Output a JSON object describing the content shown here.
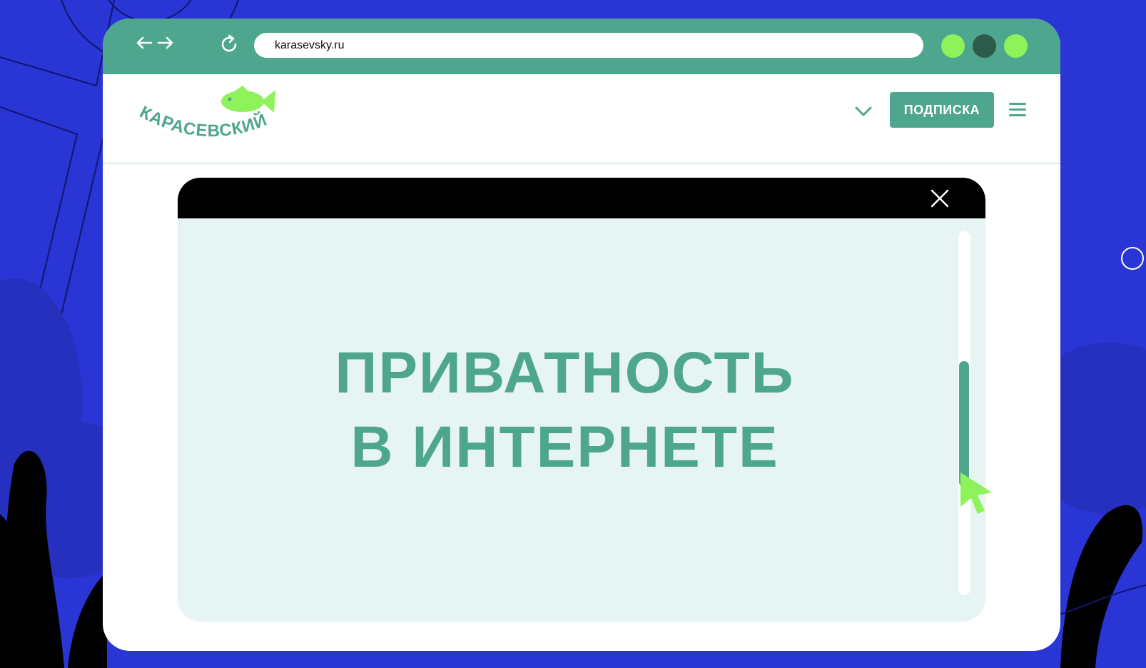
{
  "browser": {
    "url": "karasevsky.ru",
    "traffic_dots": [
      "#8ef25a",
      "#2e5a4c",
      "#8ef25a"
    ]
  },
  "site": {
    "logo_text": "КАРАСЕВСКИЙ",
    "subscribe_label": "ПОДПИСКА"
  },
  "modal": {
    "headline_line1": "ПРИВАТНОСТЬ",
    "headline_line2": "В ИНТЕРНЕТЕ",
    "scroll_position": 0.37
  },
  "colors": {
    "background": "#2a35d6",
    "accent": "#4fa68e",
    "fish": "#8ef25a",
    "modal_bg": "#e7f4f4"
  },
  "icons": [
    "back-arrow-icon",
    "forward-arrow-icon",
    "reload-icon",
    "chevron-down-icon",
    "hamburger-menu-icon",
    "close-icon",
    "fish-icon",
    "mouse-pointer-icon"
  ]
}
